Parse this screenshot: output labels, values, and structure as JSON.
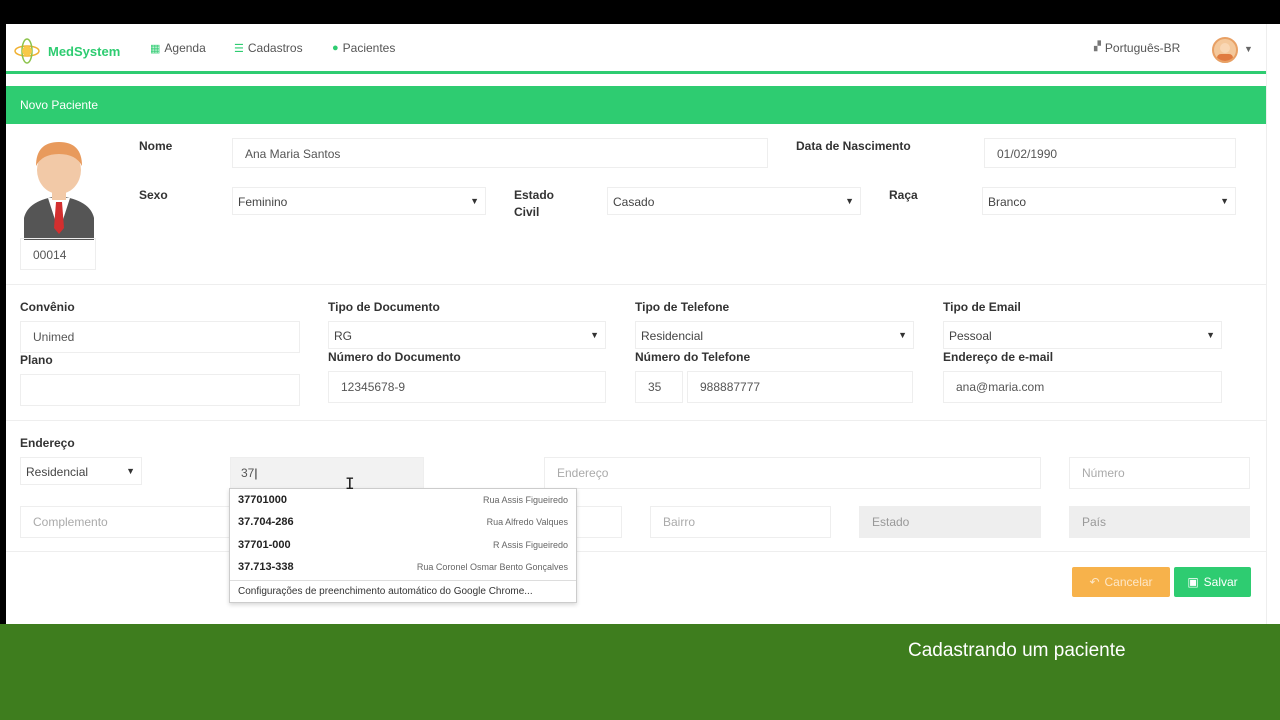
{
  "nav": {
    "brand": "MedSystem",
    "items": [
      {
        "icon": "calendar-icon",
        "label": "Agenda"
      },
      {
        "icon": "database-icon",
        "label": "Cadastros"
      },
      {
        "icon": "user-icon",
        "label": "Pacientes"
      }
    ],
    "language": "Português-BR"
  },
  "panel": {
    "title": "Novo Paciente"
  },
  "patient": {
    "id": "00014",
    "nome_label": "Nome",
    "nome": "Ana Maria Santos",
    "nascimento_label": "Data de Nascimento",
    "nascimento": "01/02/1990",
    "sexo_label": "Sexo",
    "sexo": "Feminino",
    "estado_civil_label_1": "Estado",
    "estado_civil_label_2": "Civil",
    "estado_civil": "Casado",
    "raca_label": "Raça",
    "raca": "Branco"
  },
  "contact": {
    "convenio_label": "Convênio",
    "convenio": "Unimed",
    "plano_label": "Plano",
    "plano": "",
    "tipo_doc_label": "Tipo de Documento",
    "tipo_doc": "RG",
    "num_doc_label": "Número do Documento",
    "num_doc": "12345678-9",
    "tipo_tel_label": "Tipo de Telefone",
    "tipo_tel": "Residencial",
    "num_tel_label": "Número do Telefone",
    "ddd": "35",
    "telefone": "988887777",
    "tipo_email_label": "Tipo de Email",
    "tipo_email": "Pessoal",
    "email_label": "Endereço de e-mail",
    "email": "ana@maria.com"
  },
  "address": {
    "label": "Endereço",
    "tipo": "Residencial",
    "cep": "37",
    "endereco_ph": "Endereço",
    "numero_ph": "Número",
    "complemento_ph": "Complemento",
    "bairro_ph": "Bairro",
    "estado_ph": "Estado",
    "pais_ph": "País"
  },
  "autocomplete": {
    "items": [
      {
        "code": "37701000",
        "desc": "Rua Assis Figueiredo"
      },
      {
        "code": "37.704-286",
        "desc": "Rua Alfredo Valques"
      },
      {
        "code": "37701-000",
        "desc": "R Assis Figueiredo"
      },
      {
        "code": "37.713-338",
        "desc": "Rua Coronel Osmar Bento Gonçalves"
      }
    ],
    "footer": "Configurações de preenchimento automático do Google Chrome..."
  },
  "buttons": {
    "cancel": "Cancelar",
    "save": "Salvar"
  },
  "caption": "Cadastrando um paciente",
  "colors": {
    "accent": "#2ecc71",
    "warning": "#f7b24b",
    "caption_bg": "#3e7d1e"
  }
}
